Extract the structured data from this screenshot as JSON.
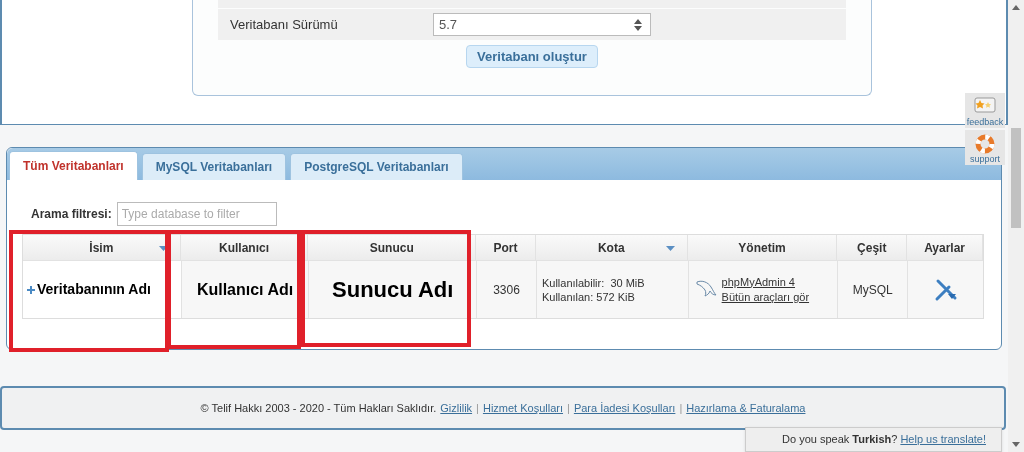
{
  "db_form": {
    "version_label": "Veritabanı Sürümü",
    "version_value": "5.7",
    "create_button": "Veritabanı oluştur"
  },
  "tabs": [
    {
      "label": "Tüm Veritabanları",
      "selected": true
    },
    {
      "label": "MySQL Veritabanları",
      "selected": false
    },
    {
      "label": "PostgreSQL Veritabanları",
      "selected": false
    }
  ],
  "filter": {
    "label": "Arama filtresi:",
    "placeholder": "Type database to filter"
  },
  "table": {
    "columns": [
      {
        "label": "İsim",
        "sort_arrow": true
      },
      {
        "label": "Kullanıcı",
        "sort_arrow": false
      },
      {
        "label": "Sunucu",
        "sort_arrow": false
      },
      {
        "label": "Port",
        "sort_arrow": false
      },
      {
        "label": "Kota",
        "sort_arrow": true
      },
      {
        "label": "Yönetim",
        "sort_arrow": false
      },
      {
        "label": "Çeşit",
        "sort_arrow": false
      },
      {
        "label": "Ayarlar",
        "sort_arrow": false
      }
    ],
    "rows": [
      {
        "name": "Veritabanının Adı",
        "expanded": false,
        "user": "Kullanıcı Adı",
        "server": "Sunucu Adı",
        "port": "3306",
        "quota": [
          "Kullanılabilir:  30 MiB",
          "Kullanılan: 572 KiB"
        ],
        "links": [
          "phpMyAdmin 4",
          "Bütün araçları gör"
        ],
        "type": "MySQL"
      }
    ]
  },
  "footer": {
    "copyright": "© Telif Hakkı 2003 - 2020 - Tüm Hakları Saklıdır.",
    "separator": "|",
    "links": [
      "Gizlilik",
      "Hizmet Koşulları",
      "Para İadesi Koşulları",
      "Hazırlama & Faturalama"
    ]
  },
  "translate": {
    "question": "Do you speak **Turkish**?",
    "link": "Help us translate!"
  },
  "side_widgets": [
    "feedback",
    "support"
  ]
}
